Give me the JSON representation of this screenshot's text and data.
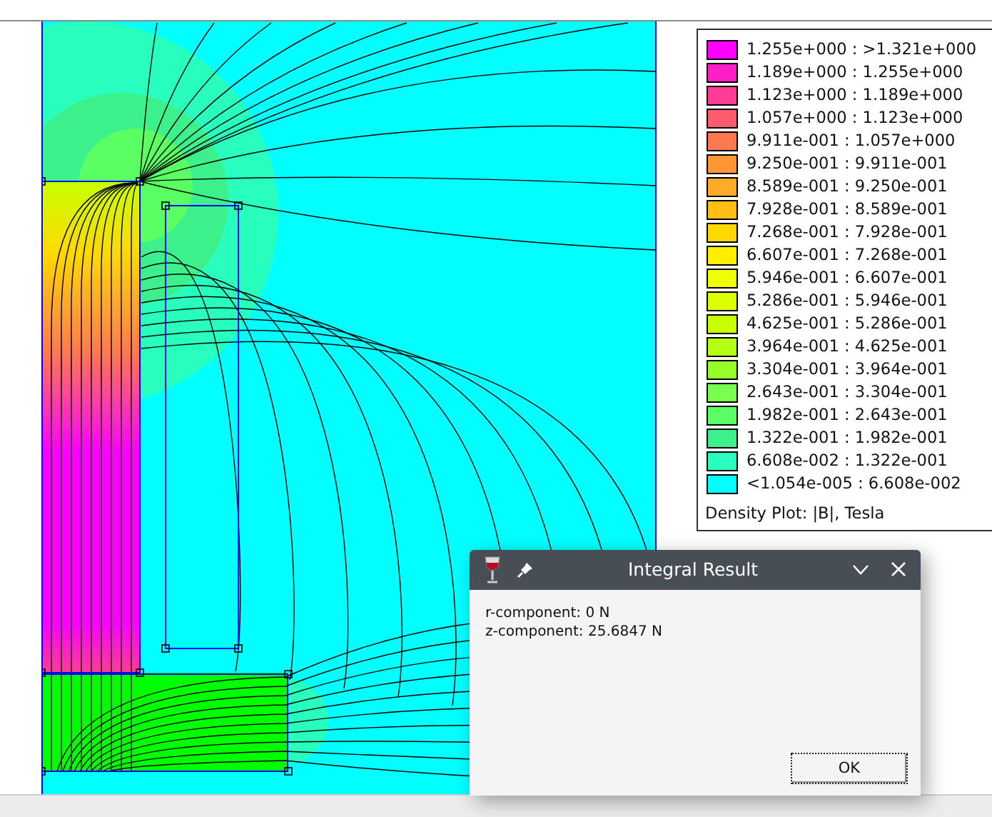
{
  "legend": {
    "entries": [
      {
        "label": "1.255e+000 : >1.321e+000",
        "color": "#ff00ff"
      },
      {
        "label": "1.189e+000 : 1.255e+000",
        "color": "#ff1ec8"
      },
      {
        "label": "1.123e+000 : 1.189e+000",
        "color": "#ff3c96"
      },
      {
        "label": "1.057e+000 : 1.123e+000",
        "color": "#ff5a6e"
      },
      {
        "label": "9.911e-001 : 1.057e+000",
        "color": "#ff7850"
      },
      {
        "label": "9.250e-001 : 9.911e-001",
        "color": "#ff9632"
      },
      {
        "label": "8.589e-001 : 9.250e-001",
        "color": "#ffaa28"
      },
      {
        "label": "7.928e-001 : 8.589e-001",
        "color": "#ffbe14"
      },
      {
        "label": "7.268e-001 : 7.928e-001",
        "color": "#ffd800"
      },
      {
        "label": "6.607e-001 : 7.268e-001",
        "color": "#ffee00"
      },
      {
        "label": "5.946e-001 : 6.607e-001",
        "color": "#f0ff00"
      },
      {
        "label": "5.286e-001 : 5.946e-001",
        "color": "#dcff00"
      },
      {
        "label": "4.625e-001 : 5.286e-001",
        "color": "#c8ff00"
      },
      {
        "label": "3.964e-001 : 4.625e-001",
        "color": "#b4ff14"
      },
      {
        "label": "3.304e-001 : 3.964e-001",
        "color": "#96ff28"
      },
      {
        "label": "2.643e-001 : 3.304e-001",
        "color": "#78ff50"
      },
      {
        "label": "1.982e-001 : 2.643e-001",
        "color": "#5aff64"
      },
      {
        "label": "1.322e-001 : 1.982e-001",
        "color": "#3cf08c"
      },
      {
        "label": "6.608e-002 : 1.322e-001",
        "color": "#28ffbe"
      },
      {
        "label": "<1.054e-005 : 6.608e-002",
        "color": "#00ffff"
      }
    ],
    "caption": "Density Plot: |B|, Tesla"
  },
  "dialog": {
    "title": "Integral Result",
    "lines": [
      "r-component: 0 N",
      "z-component: 25.6847 N"
    ],
    "buttons": [
      "OK"
    ]
  }
}
